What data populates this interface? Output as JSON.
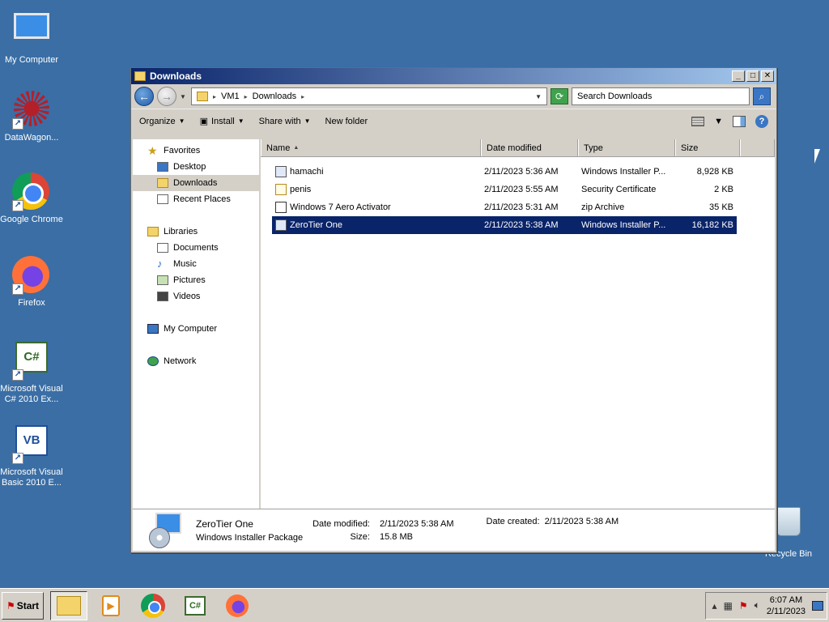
{
  "desktop": {
    "icons": [
      {
        "label": "My Computer",
        "icon": "computer-icon"
      },
      {
        "label": "DataWagon...",
        "icon": "datawagon-icon"
      },
      {
        "label": "Google Chrome",
        "icon": "chrome-icon"
      },
      {
        "label": "Firefox",
        "icon": "firefox-icon"
      },
      {
        "label": "Microsoft Visual C# 2010 Ex...",
        "icon": "csharp-icon"
      },
      {
        "label": "Microsoft Visual Basic 2010 E...",
        "icon": "vb-icon"
      },
      {
        "label": "Recycle Bin",
        "icon": "recycle-bin-icon"
      }
    ],
    "shortcut_glyph": "↗"
  },
  "window": {
    "title": "Downloads",
    "controls": {
      "minimize": "_",
      "maximize": "□",
      "close": "✕"
    },
    "address": {
      "crumbs": [
        "VM1",
        "Downloads"
      ],
      "separator": "▸",
      "search_placeholder": "Search Downloads"
    },
    "toolbar": {
      "organize": "Organize",
      "install": "Install",
      "share_with": "Share with",
      "new_folder": "New folder",
      "help": "?"
    },
    "nav": {
      "favorites": "Favorites",
      "desktop": "Desktop",
      "downloads": "Downloads",
      "recent_places": "Recent Places",
      "libraries": "Libraries",
      "documents": "Documents",
      "music": "Music",
      "pictures": "Pictures",
      "videos": "Videos",
      "my_computer": "My Computer",
      "network": "Network"
    },
    "columns": {
      "name": "Name",
      "date_modified": "Date modified",
      "type": "Type",
      "size": "Size"
    },
    "files": [
      {
        "name": "hamachi",
        "date": "2/11/2023 5:36 AM",
        "type": "Windows Installer P...",
        "size": "8,928 KB",
        "icon": "msi-icon"
      },
      {
        "name": "penis",
        "date": "2/11/2023 5:55 AM",
        "type": "Security Certificate",
        "size": "2 KB",
        "icon": "certificate-icon"
      },
      {
        "name": "Windows 7 Aero Activator",
        "date": "2/11/2023 5:31 AM",
        "type": "zip Archive",
        "size": "35 KB",
        "icon": "zip-icon"
      },
      {
        "name": "ZeroTier One",
        "date": "2/11/2023 5:38 AM",
        "type": "Windows Installer P...",
        "size": "16,182 KB",
        "icon": "msi-icon"
      }
    ],
    "selected_file": "ZeroTier One",
    "details": {
      "name": "ZeroTier One",
      "kind": "Windows Installer Package",
      "date_modified_label": "Date modified:",
      "date_modified": "2/11/2023 5:38 AM",
      "size_label": "Size:",
      "size": "15.8 MB",
      "date_created_label": "Date created:",
      "date_created": "2/11/2023 5:38 AM"
    }
  },
  "taskbar": {
    "start": "Start",
    "clock_time": "6:07 AM",
    "clock_date": "2/11/2023",
    "tray_arrow": "▴"
  }
}
